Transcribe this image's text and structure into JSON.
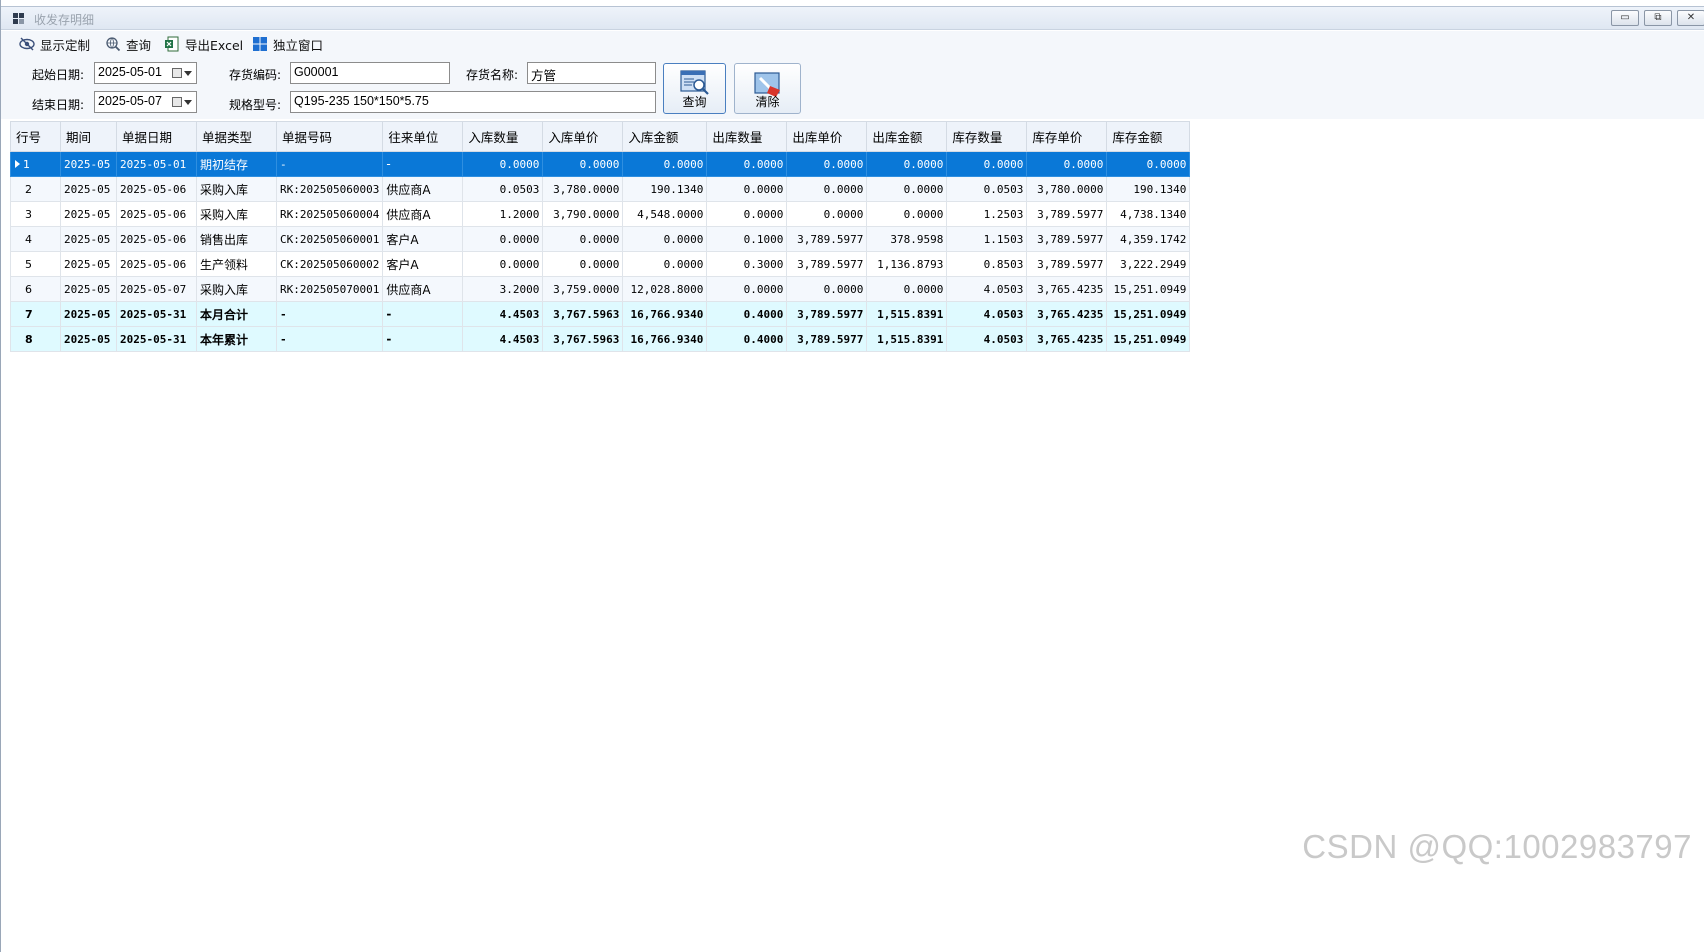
{
  "window": {
    "title": "收发存明细",
    "minimize_symbol": "▭",
    "restore_symbol": "⧉",
    "close_symbol": "✕"
  },
  "toolbar": {
    "items": [
      {
        "label": "显示定制",
        "icon": "eye-settings-icon"
      },
      {
        "label": "查询",
        "icon": "search-globe-icon"
      },
      {
        "label": "导出Excel",
        "icon": "excel-icon"
      },
      {
        "label": "独立窗口",
        "icon": "windows-grid-icon"
      }
    ]
  },
  "filters": {
    "start_date_label": "起始日期:",
    "start_date": "2025-05-01",
    "end_date_label": "结束日期:",
    "end_date": "2025-05-07",
    "code_label": "存货编码:",
    "code": "G00001",
    "name_label": "存货名称:",
    "name": "方管",
    "spec_label": "规格型号:",
    "spec": "Q195-235 150*150*5.75",
    "query_button": "查询",
    "clear_button": "清除"
  },
  "grid": {
    "columns": [
      "行号",
      "期间",
      "单据日期",
      "单据类型",
      "单据号码",
      "往来单位",
      "入库数量",
      "入库单价",
      "入库金额",
      "出库数量",
      "出库单价",
      "出库金额",
      "库存数量",
      "库存单价",
      "库存金额"
    ],
    "rows": [
      [
        "1",
        "2025-05",
        "2025-05-01",
        "期初结存",
        "-",
        "-",
        "0.0000",
        "0.0000",
        "0.0000",
        "0.0000",
        "0.0000",
        "0.0000",
        "0.0000",
        "0.0000",
        "0.0000"
      ],
      [
        "2",
        "2025-05",
        "2025-05-06",
        "采购入库",
        "RK:202505060003",
        "供应商A",
        "0.0503",
        "3,780.0000",
        "190.1340",
        "0.0000",
        "0.0000",
        "0.0000",
        "0.0503",
        "3,780.0000",
        "190.1340"
      ],
      [
        "3",
        "2025-05",
        "2025-05-06",
        "采购入库",
        "RK:202505060004",
        "供应商A",
        "1.2000",
        "3,790.0000",
        "4,548.0000",
        "0.0000",
        "0.0000",
        "0.0000",
        "1.2503",
        "3,789.5977",
        "4,738.1340"
      ],
      [
        "4",
        "2025-05",
        "2025-05-06",
        "销售出库",
        "CK:202505060001",
        "客户A",
        "0.0000",
        "0.0000",
        "0.0000",
        "0.1000",
        "3,789.5977",
        "378.9598",
        "1.1503",
        "3,789.5977",
        "4,359.1742"
      ],
      [
        "5",
        "2025-05",
        "2025-05-06",
        "生产领料",
        "CK:202505060002",
        "客户A",
        "0.0000",
        "0.0000",
        "0.0000",
        "0.3000",
        "3,789.5977",
        "1,136.8793",
        "0.8503",
        "3,789.5977",
        "3,222.2949"
      ],
      [
        "6",
        "2025-05",
        "2025-05-07",
        "采购入库",
        "RK:202505070001",
        "供应商A",
        "3.2000",
        "3,759.0000",
        "12,028.8000",
        "0.0000",
        "0.0000",
        "0.0000",
        "4.0503",
        "3,765.4235",
        "15,251.0949"
      ],
      [
        "7",
        "2025-05",
        "2025-05-31",
        "本月合计",
        "-",
        "-",
        "4.4503",
        "3,767.5963",
        "16,766.9340",
        "0.4000",
        "3,789.5977",
        "1,515.8391",
        "4.0503",
        "3,765.4235",
        "15,251.0949"
      ],
      [
        "8",
        "2025-05",
        "2025-05-31",
        "本年累计",
        "-",
        "-",
        "4.4503",
        "3,767.5963",
        "16,766.9340",
        "0.4000",
        "3,789.5977",
        "1,515.8391",
        "4.0503",
        "3,765.4235",
        "15,251.0949"
      ]
    ]
  },
  "watermark": "CSDN @QQ:1002983797",
  "colors": {
    "selection": "#0a78d7",
    "summary_row": "#dffaff",
    "header_bg": "#eef3fa"
  }
}
